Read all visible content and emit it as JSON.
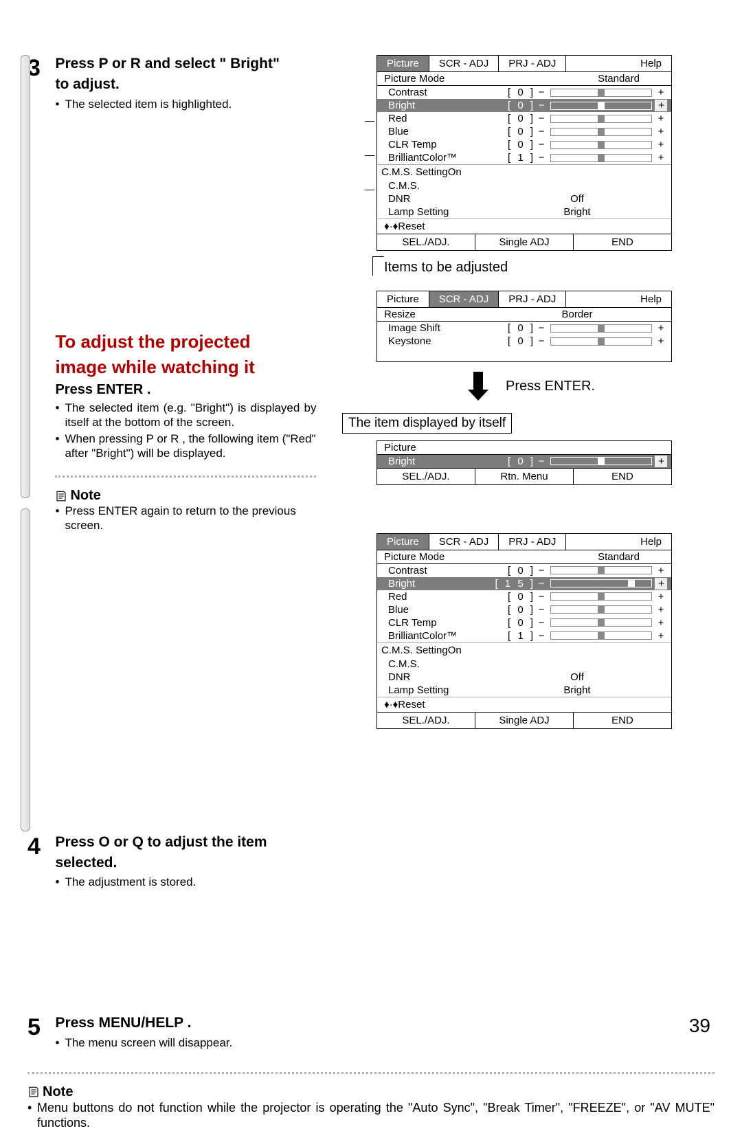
{
  "steps": {
    "s3": {
      "num": "3",
      "title1": "Press P or R and select \" Bright\"",
      "title2": "to adjust.",
      "b1": "The selected item is highlighted."
    },
    "red_heading_l1": "To  adjust the projected",
    "red_heading_l2": "image while watching it",
    "sub_title": "Press ENTER .",
    "sub_b1": "The selected item (e.g. \"Bright\") is displayed by itself at the bottom of the screen.",
    "sub_b2": "When pressing P or R , the following item (\"Red\" after \"Bright\") will be displayed.",
    "note_label": "Note",
    "note3": "Press ENTER again to return to the previous screen.",
    "s4": {
      "num": "4",
      "title1": "Press O or Q to adjust the item",
      "title2": "selected.",
      "b1": "The adjustment is stored."
    },
    "s5": {
      "num": "5",
      "title": "Press MENU/HELP   .",
      "b1": "The menu screen will disappear."
    }
  },
  "tabs": {
    "picture": "Picture",
    "scr": "SCR - ADJ",
    "prj": "PRJ - ADJ",
    "help": "Help"
  },
  "osd": {
    "picture_mode": "Picture Mode",
    "standard": "Standard",
    "rows": [
      "Contrast",
      "Bright",
      "Red",
      "Blue",
      "CLR Temp",
      "BrilliantColor™"
    ],
    "vals0": [
      "[    0 ]",
      "[    0 ]",
      "[    0 ]",
      "[    0 ]",
      "[    0 ]",
      "[    1 ]"
    ],
    "vals15": [
      "[    0 ]",
      "[  1 5 ]",
      "[    0 ]",
      "[    0 ]",
      "[    0 ]",
      "[    1 ]"
    ],
    "cms_setting": "C.M.S. Setting",
    "on": "On",
    "cms": "C.M.S.",
    "dnr": "DNR",
    "off": "Off",
    "lamp": "Lamp Setting",
    "bright": "Bright",
    "reset": "♦·♦Reset",
    "sel": "SEL./ADJ.",
    "single": "Single ADJ",
    "end": "END",
    "rtn": "Rtn. Menu"
  },
  "items_adjusted": "Items to be adjusted",
  "scr_rows": {
    "resize": "Resize",
    "border": "Border",
    "imgshift": "Image Shift",
    "keystone": "Keystone",
    "v": "[    0 ]"
  },
  "press_enter": "Press ENTER.",
  "item_by_itself": "The item displayed by itself",
  "bottom_note": "Menu buttons do not function while the projector is operating the \"Auto Sync\", \"Break Timer\", \"FREEZE\", or \"AV MUTE\" functions.",
  "page": "39"
}
